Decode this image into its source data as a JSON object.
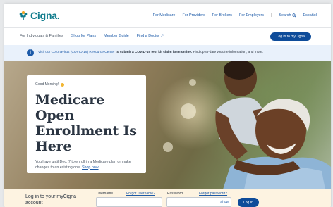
{
  "brand": {
    "name": "Cigna.",
    "accent": "#0f7b8c",
    "primary": "#0e4c9a",
    "link": "#1c5aa8"
  },
  "topnav": {
    "items": [
      "For Medicare",
      "For Providers",
      "For Brokers",
      "For Employers"
    ],
    "separator": "|",
    "search_label": "Search",
    "language": "Español"
  },
  "subnav": {
    "audience": "For Individuals & Families",
    "links": [
      "Shop for Plans",
      "Member Guide",
      "Find a Doctor"
    ],
    "login_button": "Log in to myCigna"
  },
  "alert": {
    "link_text": "Visit our Coronavirus (COVID-19) Resource Center",
    "bold_text": "to submit a COVID-19 test kit claim form online.",
    "rest_text": "Find up-to-date vaccine information, and more."
  },
  "hero": {
    "greeting": "Good Morning!",
    "headline": "Medicare Open Enrollment Is Here",
    "description": "You have until Dec. 7 to enroll in a Medicare plan or make changes to an existing one.",
    "cta_link": "Shop now"
  },
  "login": {
    "title": "Log in to your myCigna account",
    "username_label": "Username",
    "forgot_username": "Forgot username?",
    "password_label": "Password",
    "forgot_password": "Forgot password?",
    "show_label": "Show",
    "button": "Log In"
  }
}
